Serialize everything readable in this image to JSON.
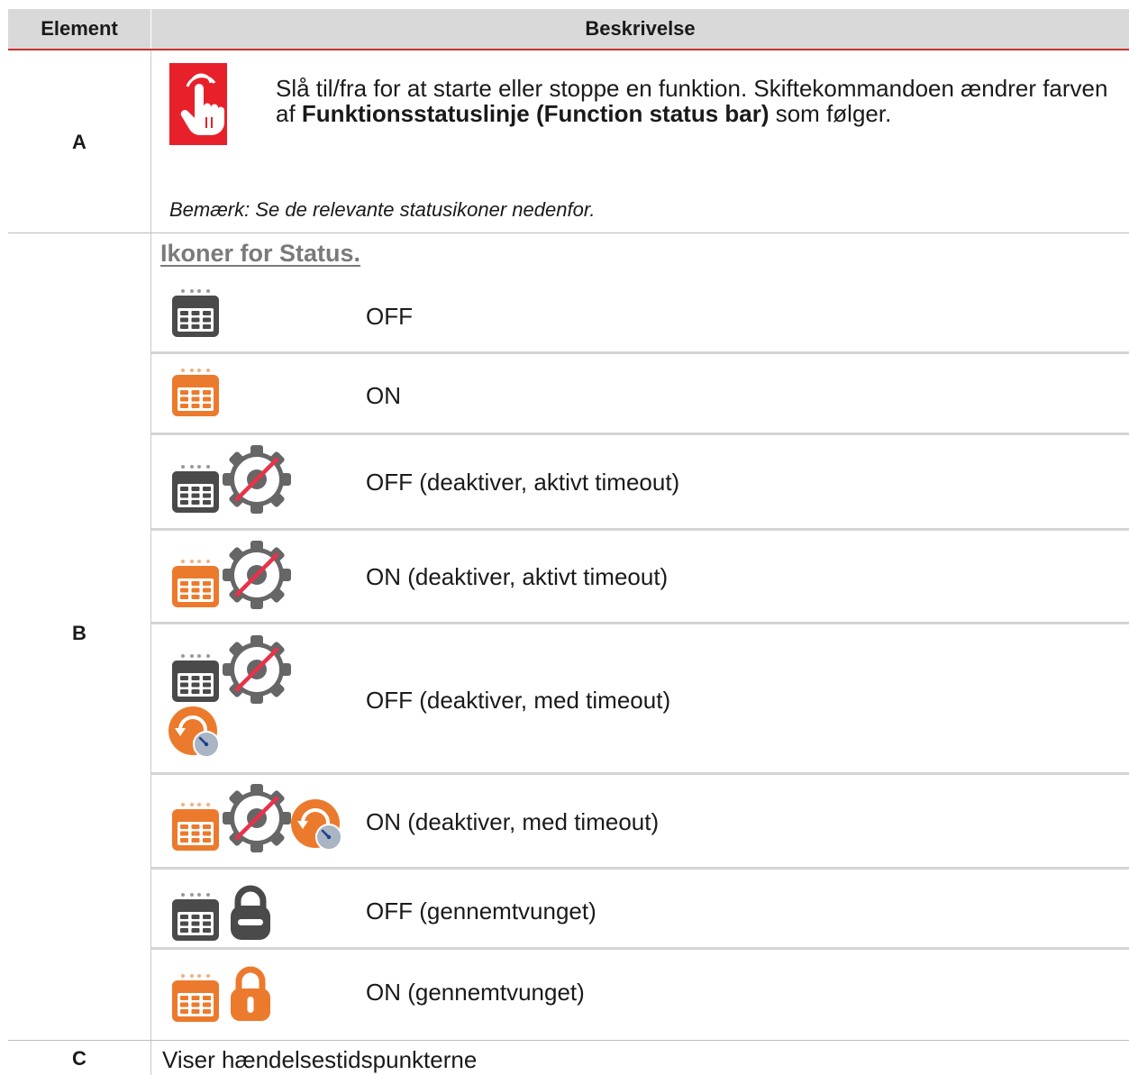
{
  "table": {
    "headers": {
      "element": "Element",
      "description": "Beskrivelse"
    },
    "rows": [
      {
        "letter": "A",
        "icon": "touch-toggle-icon",
        "text_before": "Slå til/fra for at starte eller stoppe en funktion. Skiftekommandoen ændrer farven af ",
        "text_bold": "Funktionsstatuslinje (Function status bar)",
        "text_after": " som følger.",
        "note": "Bemærk: Se de relevante statusikoner nedenfor."
      },
      {
        "letter": "B",
        "title": "Ikoner for Status.",
        "statuses": [
          {
            "label": "OFF",
            "icons": [
              "calendar-gray-icon"
            ]
          },
          {
            "label": "ON",
            "icons": [
              "calendar-orange-icon"
            ]
          },
          {
            "label": "OFF (deaktiver, aktivt timeout)",
            "icons": [
              "calendar-gray-icon",
              "gear-disabled-icon"
            ]
          },
          {
            "label": "ON (deaktiver, aktivt timeout)",
            "icons": [
              "calendar-orange-icon",
              "gear-disabled-icon"
            ]
          },
          {
            "label": "OFF (deaktiver, med timeout)",
            "icons": [
              "calendar-gray-icon",
              "gear-disabled-icon",
              "timeout-icon"
            ]
          },
          {
            "label": "ON (deaktiver, med timeout)",
            "icons": [
              "calendar-orange-icon",
              "gear-disabled-icon",
              "timeout-icon"
            ]
          },
          {
            "label": "OFF (gennemtvunget)",
            "icons": [
              "calendar-gray-icon",
              "lock-gray-icon"
            ]
          },
          {
            "label": "ON (gennemtvunget)",
            "icons": [
              "calendar-orange-icon",
              "lock-orange-icon"
            ]
          }
        ]
      },
      {
        "letter": "C",
        "text": "Viser hændelsestidspunkterne"
      }
    ]
  },
  "colors": {
    "header_bg": "#d9d9d9",
    "header_rule": "#c73030",
    "orange": "#ec7a2c",
    "gray_icon": "#4a4a4a",
    "gear": "#666666",
    "disable_slash": "#e8324a",
    "touch_bg": "#e8202a"
  }
}
